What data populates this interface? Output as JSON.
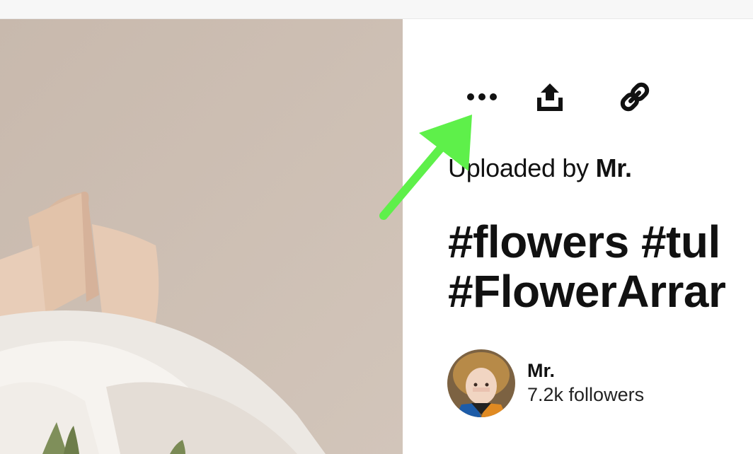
{
  "pin": {
    "uploaded_prefix": "Uploaded by ",
    "uploader": "Mr.",
    "title_line1": "#flowers #tul",
    "title_line2": "#FlowerArrar"
  },
  "creator": {
    "name": "Mr.",
    "followers": "7.2k followers"
  },
  "toolbar": {
    "more_icon": "more-options-icon",
    "share_icon": "share-upload-icon",
    "link_icon": "copy-link-icon"
  },
  "colors": {
    "annotation_arrow": "#5ef04a",
    "photo_background": "#cbbcb0",
    "text": "#111111"
  }
}
